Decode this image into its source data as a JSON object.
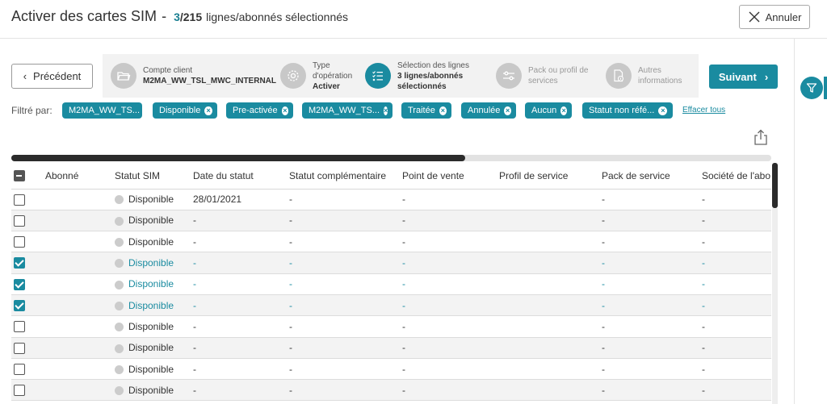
{
  "header": {
    "title": "Activer des cartes SIM",
    "separator": "-",
    "selected_count": "3",
    "total_count": "/215",
    "count_label": "lignes/abonnés sélectionnés",
    "cancel_label": "Annuler"
  },
  "nav": {
    "prev_label": "Précédent",
    "next_label": "Suivant"
  },
  "steps": [
    {
      "line1": "Compte client",
      "line2": "M2MA_WW_TSL_MWC_INTERNAL",
      "icon": "folder-icon",
      "state": "done"
    },
    {
      "line1": "Type",
      "line1b": "d'opération",
      "line2": "Activer",
      "icon": "gear-icon",
      "state": "done"
    },
    {
      "line1": "Sélection des lignes",
      "line2": "3 lignes/abonnés",
      "line3": "sélectionnés",
      "icon": "list-check-icon",
      "state": "active"
    },
    {
      "line1": "Pack ou profil de",
      "line1b": "services",
      "icon": "sliders-icon",
      "state": "disabled"
    },
    {
      "line1": "Autres",
      "line1b": "informations",
      "icon": "document-info-icon",
      "state": "disabled"
    }
  ],
  "filters": {
    "label": "Filtré par:",
    "chips": [
      "M2MA_WW_TS...",
      "Disponible",
      "Pre-activée",
      "M2MA_WW_TS...",
      "Traitée",
      "Annulée",
      "Aucun",
      "Statut non réfé..."
    ],
    "clear_all": "Effacer tous"
  },
  "table": {
    "columns": [
      "Abonné",
      "Statut SIM",
      "Date du statut",
      "Statut complémentaire",
      "Point de vente",
      "Profil de service",
      "Pack de service",
      "Société de l'abo"
    ],
    "rows": [
      {
        "checked": false,
        "abonne": "",
        "statut": "Disponible",
        "date": "28/01/2021",
        "compl": "-",
        "pdv": "-",
        "profil": "",
        "pack": "-",
        "societe": "-"
      },
      {
        "checked": false,
        "abonne": "",
        "statut": "Disponible",
        "date": "-",
        "compl": "-",
        "pdv": "-",
        "profil": "",
        "pack": "-",
        "societe": "-"
      },
      {
        "checked": false,
        "abonne": "",
        "statut": "Disponible",
        "date": "-",
        "compl": "-",
        "pdv": "-",
        "profil": "",
        "pack": "-",
        "societe": "-"
      },
      {
        "checked": true,
        "abonne": "",
        "statut": "Disponible",
        "date": "-",
        "compl": "-",
        "pdv": "-",
        "profil": "",
        "pack": "-",
        "societe": "-"
      },
      {
        "checked": true,
        "abonne": "",
        "statut": "Disponible",
        "date": "-",
        "compl": "-",
        "pdv": "-",
        "profil": "",
        "pack": "-",
        "societe": "-"
      },
      {
        "checked": true,
        "abonne": "",
        "statut": "Disponible",
        "date": "-",
        "compl": "-",
        "pdv": "-",
        "profil": "",
        "pack": "-",
        "societe": "-"
      },
      {
        "checked": false,
        "abonne": "",
        "statut": "Disponible",
        "date": "-",
        "compl": "-",
        "pdv": "-",
        "profil": "",
        "pack": "-",
        "societe": "-"
      },
      {
        "checked": false,
        "abonne": "",
        "statut": "Disponible",
        "date": "-",
        "compl": "-",
        "pdv": "-",
        "profil": "",
        "pack": "-",
        "societe": "-"
      },
      {
        "checked": false,
        "abonne": "",
        "statut": "Disponible",
        "date": "-",
        "compl": "-",
        "pdv": "-",
        "profil": "",
        "pack": "-",
        "societe": "-"
      },
      {
        "checked": false,
        "abonne": "",
        "statut": "Disponible",
        "date": "-",
        "compl": "-",
        "pdv": "-",
        "profil": "",
        "pack": "-",
        "societe": "-"
      }
    ]
  },
  "colors": {
    "accent": "#1a8ba0",
    "status_dot": "#cccccc"
  }
}
